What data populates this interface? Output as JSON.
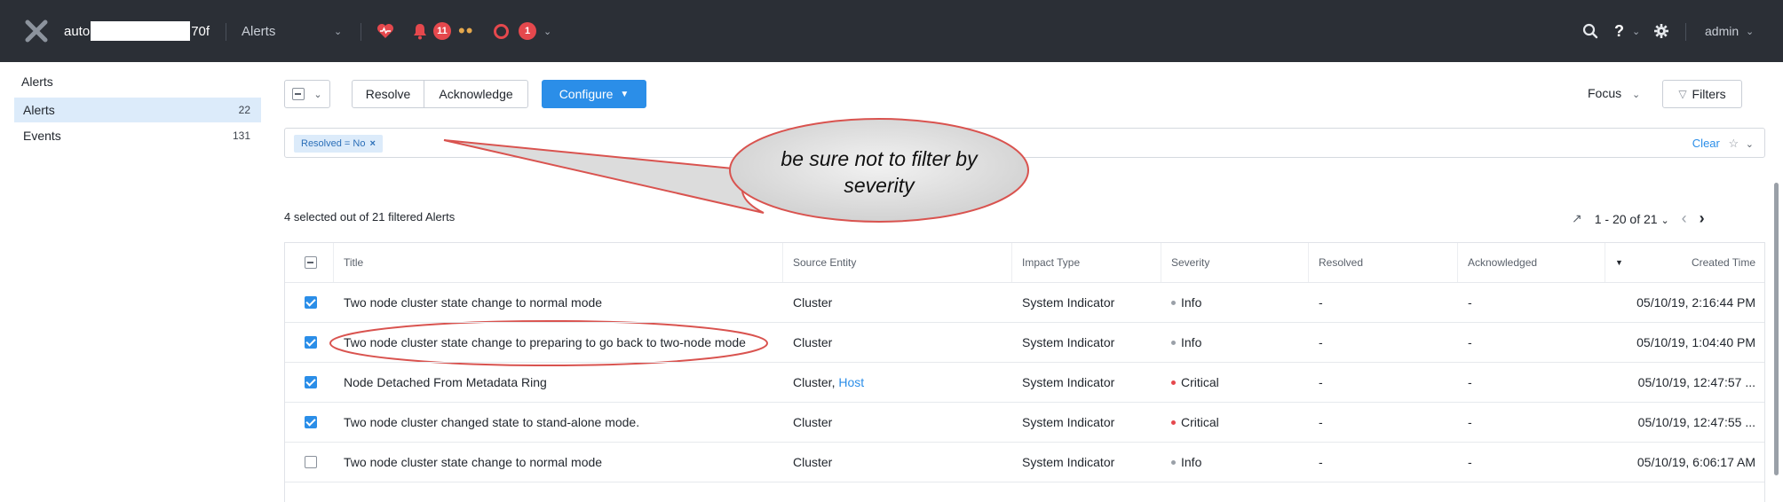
{
  "header": {
    "cluster_prefix": "auto",
    "cluster_suffix": "70f",
    "section": "Alerts",
    "alert_count": "11",
    "event_count": "1",
    "user": "admin",
    "help": "?"
  },
  "sidebar": {
    "title": "Alerts",
    "items": [
      {
        "label": "Alerts",
        "count": "22"
      },
      {
        "label": "Events",
        "count": "131"
      }
    ]
  },
  "toolbar": {
    "resolve": "Resolve",
    "acknowledge": "Acknowledge",
    "configure": "Configure",
    "focus": "Focus",
    "filters": "Filters"
  },
  "filter": {
    "chip": "Resolved = No",
    "clear": "Clear"
  },
  "summary": "4 selected out of 21 filtered Alerts",
  "pager": {
    "range": "1 - 20 of 21"
  },
  "annotation": "be sure not to filter by severity",
  "table": {
    "headers": [
      "Title",
      "Source Entity",
      "Impact Type",
      "Severity",
      "Resolved",
      "Acknowledged",
      "Created Time"
    ],
    "rows": [
      {
        "checked": true,
        "title": "Two node cluster state change to normal mode",
        "source": "Cluster",
        "source_link": "",
        "impact": "System Indicator",
        "severity": "Info",
        "resolved": "-",
        "ack": "-",
        "created": "05/10/19, 2:16:44 PM"
      },
      {
        "checked": true,
        "title": "Two node cluster state change to preparing to go back to two-node mode",
        "source": "Cluster",
        "source_link": "",
        "impact": "System Indicator",
        "severity": "Info",
        "resolved": "-",
        "ack": "-",
        "created": "05/10/19, 1:04:40 PM"
      },
      {
        "checked": true,
        "title": "Node Detached From Metadata Ring",
        "source": "Cluster, ",
        "source_link": "Host",
        "impact": "System Indicator",
        "severity": "Critical",
        "resolved": "-",
        "ack": "-",
        "created": "05/10/19, 12:47:57 ..."
      },
      {
        "checked": true,
        "title": "Two node cluster changed state to stand-alone mode.",
        "source": "Cluster",
        "source_link": "",
        "impact": "System Indicator",
        "severity": "Critical",
        "resolved": "-",
        "ack": "-",
        "created": "05/10/19, 12:47:55 ..."
      },
      {
        "checked": false,
        "title": "Two node cluster state change to normal mode",
        "source": "Cluster",
        "source_link": "",
        "impact": "System Indicator",
        "severity": "Info",
        "resolved": "-",
        "ack": "-",
        "created": "05/10/19, 6:06:17 AM"
      }
    ]
  }
}
